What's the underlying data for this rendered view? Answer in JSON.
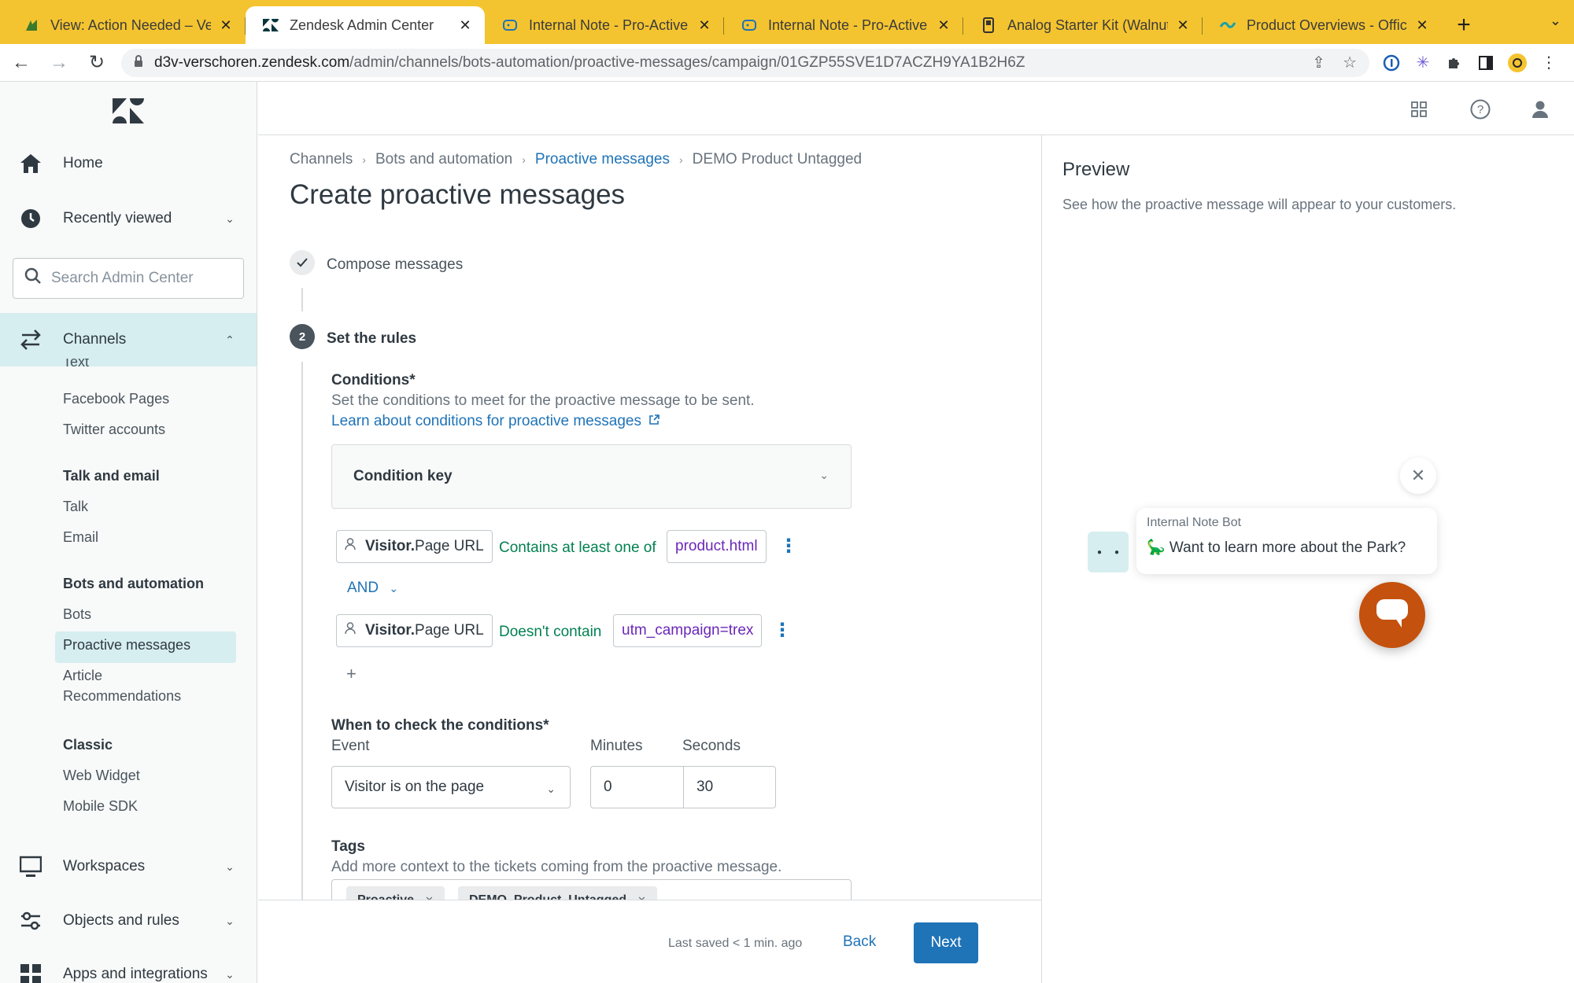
{
  "browser": {
    "tabs": [
      {
        "title": "View: Action Needed – Versch",
        "icon": "page-icon"
      },
      {
        "title": "Zendesk Admin Center",
        "icon": "zendesk-icon",
        "active": true
      },
      {
        "title": "Internal Note - Pro-Active Me",
        "icon": "chat-icon"
      },
      {
        "title": "Internal Note - Pro-Active Me",
        "icon": "chat-icon"
      },
      {
        "title": "Analog Starter Kit (Walnut) –",
        "icon": "product-icon"
      },
      {
        "title": "Product Overviews - Official",
        "icon": "wave-icon"
      }
    ],
    "url_host": "d3v-verschoren.zendesk.com",
    "url_path": "/admin/channels/bots-automation/proactive-messages/campaign/01GZP55SVE1D7ACZH9YA1B2H6Z"
  },
  "sidebar": {
    "home": "Home",
    "recently_viewed": "Recently viewed",
    "search_placeholder": "Search Admin Center",
    "channels": "Channels",
    "channel_items": {
      "text": "Text",
      "facebook": "Facebook Pages",
      "twitter": "Twitter accounts",
      "talk_email_head": "Talk and email",
      "talk": "Talk",
      "email": "Email",
      "bots_head": "Bots and automation",
      "bots": "Bots",
      "proactive": "Proactive messages",
      "article_recs_1": "Article",
      "article_recs_2": "Recommendations",
      "classic_head": "Classic",
      "web_widget": "Web Widget",
      "mobile_sdk": "Mobile SDK"
    },
    "workspaces": "Workspaces",
    "objects_rules": "Objects and rules",
    "apps_integrations": "Apps and integrations"
  },
  "breadcrumb": [
    "Channels",
    "Bots and automation",
    "Proactive messages",
    "DEMO Product Untagged"
  ],
  "page_title": "Create proactive messages",
  "steps": {
    "step1": "Compose messages",
    "step2_num": "2",
    "step2": "Set the rules"
  },
  "conditions": {
    "label": "Conditions*",
    "hint": "Set the conditions to meet for the proactive message to be sent.",
    "learn_link": "Learn about conditions for proactive messages",
    "condition_key": "Condition key",
    "rows": [
      {
        "subject_bold": "Visitor.",
        "subject_rest": "Page URL",
        "operator": "Contains at least one of",
        "value": "product.html"
      },
      {
        "subject_bold": "Visitor.",
        "subject_rest": "Page URL",
        "operator": "Doesn't contain",
        "value": "utm_campaign=trex"
      }
    ],
    "and_label": "AND",
    "add": "+"
  },
  "when": {
    "label": "When to check the conditions*",
    "event_label": "Event",
    "event_value": "Visitor is on the page",
    "minutes_label": "Minutes",
    "minutes_value": "0",
    "seconds_label": "Seconds",
    "seconds_value": "30"
  },
  "tags": {
    "label": "Tags",
    "hint": "Add more context to the tickets coming from the proactive message.",
    "items": [
      "Proactive",
      "DEMO_Product_Untagged"
    ]
  },
  "footer": {
    "saved": "Last saved < 1 min. ago",
    "back": "Back",
    "next": "Next"
  },
  "preview": {
    "title": "Preview",
    "subtitle": "See how the proactive message will appear to your customers.",
    "bot_name": "Internal Note Bot",
    "message": "🦕 Want to learn more about the Park?"
  },
  "colors": {
    "accent": "#1f73b7",
    "tabbar": "#f4c430",
    "selected_nav": "#d6eef0",
    "operator_green": "#038153",
    "value_purple": "#6a27b8",
    "launcher": "#c4510d"
  }
}
